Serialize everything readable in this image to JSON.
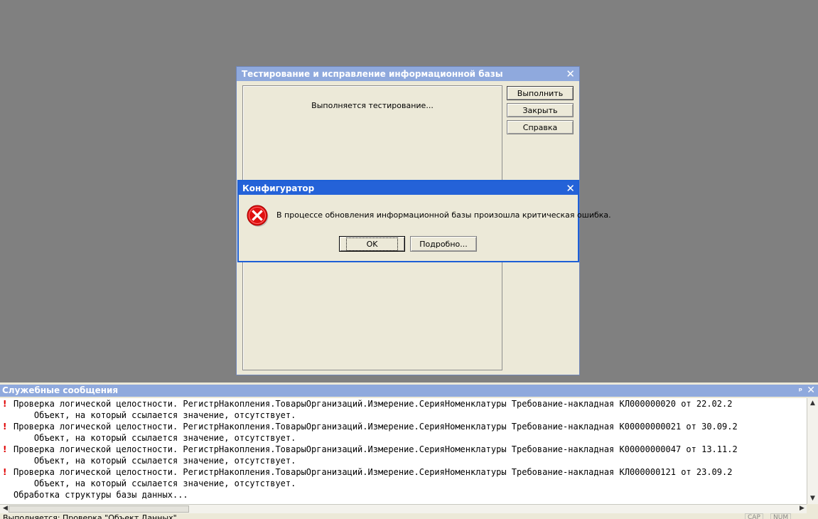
{
  "test_dialog": {
    "title": "Тестирование и исправление информационной базы",
    "close_glyph": "✕",
    "status": "Выполняется тестирование...",
    "buttons": {
      "run": "Выполнить",
      "close": "Закрыть",
      "help": "Справка"
    }
  },
  "error_dialog": {
    "title": "Конфигуратор",
    "close_glyph": "✕",
    "icon": "error-icon",
    "message": "В процессе обновления информационной базы произошла критическая ошибка.",
    "buttons": {
      "ok": "OK",
      "details": "Подробно..."
    }
  },
  "messages": {
    "title": "Служебные сообщения",
    "pin_glyph": "ᵖ",
    "close_glyph": "✕",
    "error_mark": "!",
    "lines": [
      "Проверка логической целостности. РегистрНакопления.ТоварыОрганизаций.Измерение.СерияНоменклатуры Требование-накладная КЛ000000020 от 22.02.2",
      "    Объект, на который ссылается значение, отсутствует.",
      "Проверка логической целостности. РегистрНакопления.ТоварыОрганизаций.Измерение.СерияНоменклатуры Требование-накладная К00000000021 от 30.09.2",
      "    Объект, на который ссылается значение, отсутствует.",
      "Проверка логической целостности. РегистрНакопления.ТоварыОрганизаций.Измерение.СерияНоменклатуры Требование-накладная К00000000047 от 13.11.2",
      "    Объект, на который ссылается значение, отсутствует.",
      "Проверка логической целостности. РегистрНакопления.ТоварыОрганизаций.Измерение.СерияНоменклатуры Требование-накладная КЛ000000121 от 23.09.2",
      "    Объект, на который ссылается значение, отсутствует.",
      "Обработка структуры базы данных..."
    ]
  },
  "statusbar": {
    "text": "Выполняется: Проверка \"Объект Данных\"",
    "indicators": [
      "CAP",
      "NUM"
    ]
  },
  "colors": {
    "desktop": "#808080",
    "active_title": "#2462d8",
    "inactive_title": "#8fa9dd",
    "error_red": "#e00000"
  }
}
